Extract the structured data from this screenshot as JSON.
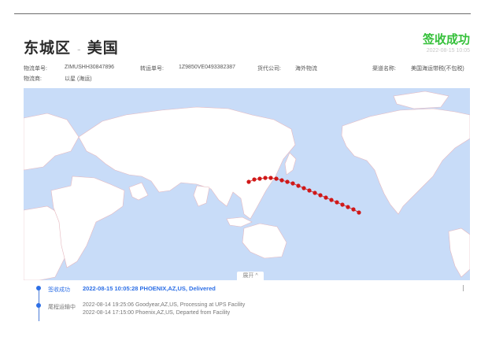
{
  "header": {
    "origin": "东城区",
    "separator": "-",
    "destination": "美国"
  },
  "status": {
    "label": "签收成功",
    "time": "2022-08-15 10:05",
    "color": "#35c03a"
  },
  "info": {
    "logistics_no_label": "物流单号:",
    "logistics_no": "ZIMUSHH30847896",
    "transfer_no_label": "转运单号:",
    "transfer_no": "1Z9850VE0493382387",
    "cargo_company_label": "货代公司:",
    "cargo_company": "海外物流",
    "channel_label": "渠道名称:",
    "channel": "美国海运带税(不包税)",
    "carrier_label": "物流商:",
    "carrier": "以星 (海运)"
  },
  "map": {
    "expand_label": "展开 ^",
    "route_color": "#d01818",
    "route_points": [
      [
        118,
        39
      ],
      [
        125,
        36
      ],
      [
        132,
        35
      ],
      [
        139,
        34
      ],
      [
        146,
        34
      ],
      [
        153,
        35
      ],
      [
        160,
        37
      ],
      [
        167,
        39
      ],
      [
        174,
        41
      ],
      [
        181,
        44
      ],
      [
        188,
        47
      ],
      [
        195,
        50
      ],
      [
        202,
        53
      ],
      [
        209,
        56
      ],
      [
        216,
        59
      ],
      [
        223,
        62
      ],
      [
        230,
        65
      ],
      [
        237,
        68
      ],
      [
        244,
        71
      ],
      [
        251,
        74
      ],
      [
        258,
        78
      ]
    ]
  },
  "timeline": {
    "items": [
      {
        "status": "签收成功",
        "text": "2022-08-15 10:05:28 PHOENIX,AZ,US, Delivered"
      },
      {
        "status": "尾程运输中",
        "lines": [
          "2022-08-14 19:25:06 Goodyear,AZ,US, Processing at UPS Facility",
          "2022-08-14 17:15:00 Phoenix,AZ,US, Departed from Facility"
        ]
      }
    ]
  }
}
